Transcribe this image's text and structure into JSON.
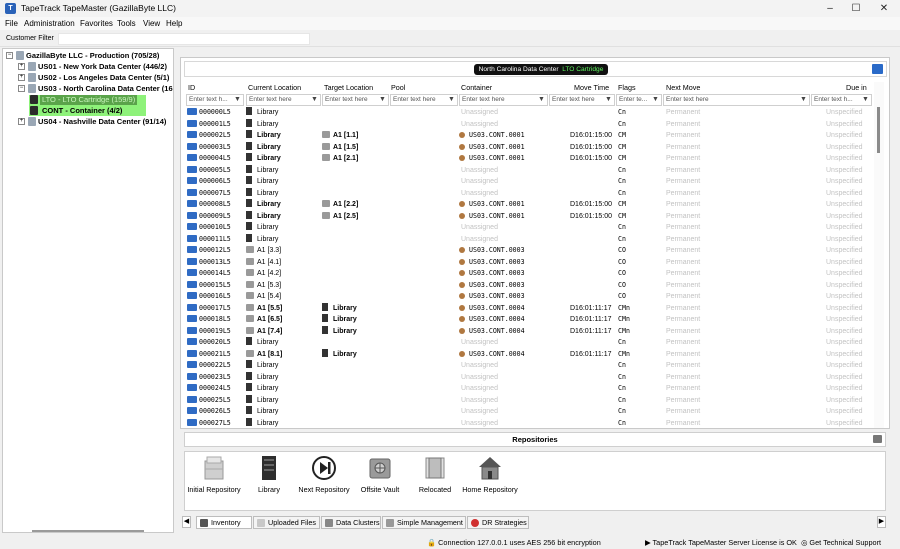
{
  "window": {
    "title": "TapeTrack TapeMaster (GazillaByte LLC)",
    "app_icon": "tapetrack-icon",
    "min_glyph": "–",
    "max_glyph": "☐",
    "close_glyph": "✕"
  },
  "menu": [
    "File",
    "Administration",
    "Favorites",
    "Tools",
    "View",
    "Help"
  ],
  "filter": {
    "label": "Customer Filter",
    "value": ""
  },
  "tree": [
    {
      "label": "GazillaByte LLC - Production (705/28)",
      "expander": "−"
    },
    {
      "label": "US01 - New York Data Center (446/2)",
      "expander": "+"
    },
    {
      "label": "US02 - Los Angeles Data Center (5/1)",
      "expander": "+"
    },
    {
      "label": "US03 - North Carolina Data Center (16",
      "expander": "−"
    },
    {
      "label": "LTO - LTO Cartridge (159/9)",
      "expander": ""
    },
    {
      "label": "CONT - Container (4/2)",
      "expander": ""
    },
    {
      "label": "US04 - Nashville Data Center (91/14)",
      "expander": "+"
    }
  ],
  "header": {
    "datacenter": "North Carolina Data Center",
    "media": "LTO Cartridge"
  },
  "columns": [
    "ID",
    "Current Location",
    "Target Location",
    "Pool",
    "Container",
    "Move Time",
    "Flags",
    "Next Move",
    "Due in"
  ],
  "filters": {
    "id": "Enter text h...",
    "current": "Enter text here",
    "target": "Enter text here",
    "pool": "Enter text here",
    "container": "Enter text here",
    "movetime": "Enter text here",
    "flags": "Enter te...",
    "nextmove": "Enter text here",
    "duein": "Enter text h..."
  },
  "rows": [
    {
      "id": "000000L5",
      "cur": "Library",
      "curb": false,
      "curt": "lib",
      "tgt": "",
      "tgtt": "",
      "cont": "Unassigned",
      "contg": true,
      "mt": "",
      "fl": "Cn",
      "nm": "Permanent",
      "due": "Unspecified"
    },
    {
      "id": "000001L5",
      "cur": "Library",
      "curb": false,
      "curt": "lib",
      "tgt": "",
      "tgtt": "",
      "cont": "Unassigned",
      "contg": true,
      "mt": "",
      "fl": "Cn",
      "nm": "Permanent",
      "due": "Unspecified"
    },
    {
      "id": "000002L5",
      "cur": "Library",
      "curb": true,
      "curt": "lib",
      "tgt": "A1 [1.1]",
      "tgtt": "slot",
      "cont": "US03.CONT.0001",
      "contg": false,
      "mt": "D16:01:15:00",
      "fl": "CM",
      "nm": "Permanent",
      "due": "Unspecified"
    },
    {
      "id": "000003L5",
      "cur": "Library",
      "curb": true,
      "curt": "lib",
      "tgt": "A1 [1.5]",
      "tgtt": "slot",
      "cont": "US03.CONT.0001",
      "contg": false,
      "mt": "D16:01:15:00",
      "fl": "CM",
      "nm": "Permanent",
      "due": "Unspecified"
    },
    {
      "id": "000004L5",
      "cur": "Library",
      "curb": true,
      "curt": "lib",
      "tgt": "A1 [2.1]",
      "tgtt": "slot",
      "cont": "US03.CONT.0001",
      "contg": false,
      "mt": "D16:01:15:00",
      "fl": "CM",
      "nm": "Permanent",
      "due": "Unspecified"
    },
    {
      "id": "000005L5",
      "cur": "Library",
      "curb": false,
      "curt": "lib",
      "tgt": "",
      "tgtt": "",
      "cont": "Unassigned",
      "contg": true,
      "mt": "",
      "fl": "Cn",
      "nm": "Permanent",
      "due": "Unspecified"
    },
    {
      "id": "000006L5",
      "cur": "Library",
      "curb": false,
      "curt": "lib",
      "tgt": "",
      "tgtt": "",
      "cont": "Unassigned",
      "contg": true,
      "mt": "",
      "fl": "Cn",
      "nm": "Permanent",
      "due": "Unspecified"
    },
    {
      "id": "000007L5",
      "cur": "Library",
      "curb": false,
      "curt": "lib",
      "tgt": "",
      "tgtt": "",
      "cont": "Unassigned",
      "contg": true,
      "mt": "",
      "fl": "Cn",
      "nm": "Permanent",
      "due": "Unspecified"
    },
    {
      "id": "000008L5",
      "cur": "Library",
      "curb": true,
      "curt": "lib",
      "tgt": "A1 [2.2]",
      "tgtt": "slot",
      "cont": "US03.CONT.0001",
      "contg": false,
      "mt": "D16:01:15:00",
      "fl": "CM",
      "nm": "Permanent",
      "due": "Unspecified"
    },
    {
      "id": "000009L5",
      "cur": "Library",
      "curb": true,
      "curt": "lib",
      "tgt": "A1 [2.5]",
      "tgtt": "slot",
      "cont": "US03.CONT.0001",
      "contg": false,
      "mt": "D16:01:15:00",
      "fl": "CM",
      "nm": "Permanent",
      "due": "Unspecified"
    },
    {
      "id": "000010L5",
      "cur": "Library",
      "curb": false,
      "curt": "lib",
      "tgt": "",
      "tgtt": "",
      "cont": "Unassigned",
      "contg": true,
      "mt": "",
      "fl": "Cn",
      "nm": "Permanent",
      "due": "Unspecified"
    },
    {
      "id": "000011L5",
      "cur": "Library",
      "curb": false,
      "curt": "lib",
      "tgt": "",
      "tgtt": "",
      "cont": "Unassigned",
      "contg": true,
      "mt": "",
      "fl": "Cn",
      "nm": "Permanent",
      "due": "Unspecified"
    },
    {
      "id": "000012L5",
      "cur": "A1 [3.3]",
      "curb": false,
      "curt": "slot",
      "tgt": "",
      "tgtt": "",
      "cont": "US03.CONT.0003",
      "contg": false,
      "mt": "",
      "fl": "CO",
      "nm": "Permanent",
      "due": "Unspecified"
    },
    {
      "id": "000013L5",
      "cur": "A1 [4.1]",
      "curb": false,
      "curt": "slot",
      "tgt": "",
      "tgtt": "",
      "cont": "US03.CONT.0003",
      "contg": false,
      "mt": "",
      "fl": "CO",
      "nm": "Permanent",
      "due": "Unspecified"
    },
    {
      "id": "000014L5",
      "cur": "A1 [4.2]",
      "curb": false,
      "curt": "slot",
      "tgt": "",
      "tgtt": "",
      "cont": "US03.CONT.0003",
      "contg": false,
      "mt": "",
      "fl": "CO",
      "nm": "Permanent",
      "due": "Unspecified"
    },
    {
      "id": "000015L5",
      "cur": "A1 [5.3]",
      "curb": false,
      "curt": "slot",
      "tgt": "",
      "tgtt": "",
      "cont": "US03.CONT.0003",
      "contg": false,
      "mt": "",
      "fl": "CO",
      "nm": "Permanent",
      "due": "Unspecified"
    },
    {
      "id": "000016L5",
      "cur": "A1 [5.4]",
      "curb": false,
      "curt": "slot",
      "tgt": "",
      "tgtt": "",
      "cont": "US03.CONT.0003",
      "contg": false,
      "mt": "",
      "fl": "CO",
      "nm": "Permanent",
      "due": "Unspecified"
    },
    {
      "id": "000017L5",
      "cur": "A1 [5.5]",
      "curb": true,
      "curt": "slot",
      "tgt": "Library",
      "tgtt": "lib",
      "cont": "US03.CONT.0004",
      "contg": false,
      "mt": "D16:01:11:17",
      "fl": "CMn",
      "nm": "Permanent",
      "due": "Unspecified"
    },
    {
      "id": "000018L5",
      "cur": "A1 [6.5]",
      "curb": true,
      "curt": "slot",
      "tgt": "Library",
      "tgtt": "lib",
      "cont": "US03.CONT.0004",
      "contg": false,
      "mt": "D16:01:11:17",
      "fl": "CMn",
      "nm": "Permanent",
      "due": "Unspecified"
    },
    {
      "id": "000019L5",
      "cur": "A1 [7.4]",
      "curb": true,
      "curt": "slot",
      "tgt": "Library",
      "tgtt": "lib",
      "cont": "US03.CONT.0004",
      "contg": false,
      "mt": "D16:01:11:17",
      "fl": "CMn",
      "nm": "Permanent",
      "due": "Unspecified"
    },
    {
      "id": "000020L5",
      "cur": "Library",
      "curb": false,
      "curt": "lib",
      "tgt": "",
      "tgtt": "",
      "cont": "Unassigned",
      "contg": true,
      "mt": "",
      "fl": "Cn",
      "nm": "Permanent",
      "due": "Unspecified"
    },
    {
      "id": "000021L5",
      "cur": "A1 [8.1]",
      "curb": true,
      "curt": "slot",
      "tgt": "Library",
      "tgtt": "lib",
      "cont": "US03.CONT.0004",
      "contg": false,
      "mt": "D16:01:11:17",
      "fl": "CMn",
      "nm": "Permanent",
      "due": "Unspecified"
    },
    {
      "id": "000022L5",
      "cur": "Library",
      "curb": false,
      "curt": "lib",
      "tgt": "",
      "tgtt": "",
      "cont": "Unassigned",
      "contg": true,
      "mt": "",
      "fl": "Cn",
      "nm": "Permanent",
      "due": "Unspecified"
    },
    {
      "id": "000023L5",
      "cur": "Library",
      "curb": false,
      "curt": "lib",
      "tgt": "",
      "tgtt": "",
      "cont": "Unassigned",
      "contg": true,
      "mt": "",
      "fl": "Cn",
      "nm": "Permanent",
      "due": "Unspecified"
    },
    {
      "id": "000024L5",
      "cur": "Library",
      "curb": false,
      "curt": "lib",
      "tgt": "",
      "tgtt": "",
      "cont": "Unassigned",
      "contg": true,
      "mt": "",
      "fl": "Cn",
      "nm": "Permanent",
      "due": "Unspecified"
    },
    {
      "id": "000025L5",
      "cur": "Library",
      "curb": false,
      "curt": "lib",
      "tgt": "",
      "tgtt": "",
      "cont": "Unassigned",
      "contg": true,
      "mt": "",
      "fl": "Cn",
      "nm": "Permanent",
      "due": "Unspecified"
    },
    {
      "id": "000026L5",
      "cur": "Library",
      "curb": false,
      "curt": "lib",
      "tgt": "",
      "tgtt": "",
      "cont": "Unassigned",
      "contg": true,
      "mt": "",
      "fl": "Cn",
      "nm": "Permanent",
      "due": "Unspecified"
    },
    {
      "id": "000027L5",
      "cur": "Library",
      "curb": false,
      "curt": "lib",
      "tgt": "",
      "tgtt": "",
      "cont": "Unassigned",
      "contg": true,
      "mt": "",
      "fl": "Cn",
      "nm": "Permanent",
      "due": "Unspecified"
    }
  ],
  "repositories": {
    "title": "Repositories",
    "items": [
      {
        "label": "Initial Repository",
        "icon": "initial-repository-icon"
      },
      {
        "label": "Library",
        "icon": "library-icon"
      },
      {
        "label": "Next Repository",
        "icon": "next-repository-icon"
      },
      {
        "label": "Offsite Vault",
        "icon": "offsite-vault-icon"
      },
      {
        "label": "Relocated",
        "icon": "relocated-icon"
      },
      {
        "label": "Home Repository",
        "icon": "home-repository-icon"
      }
    ]
  },
  "tabs": [
    "Inventory",
    "Uploaded Files",
    "Data Clusters",
    "Simple Management",
    "DR Strategies"
  ],
  "status": {
    "connection": "Connection 127.0.0.1 uses AES 256 bit encryption",
    "license": "TapeTrack TapeMaster Server License is OK",
    "support": "Get Technical Support"
  },
  "colors": {
    "accent": "#2a62b8",
    "selection": "#8ef27a",
    "pill_bg": "#111111",
    "pill_accent": "#5df25d"
  }
}
